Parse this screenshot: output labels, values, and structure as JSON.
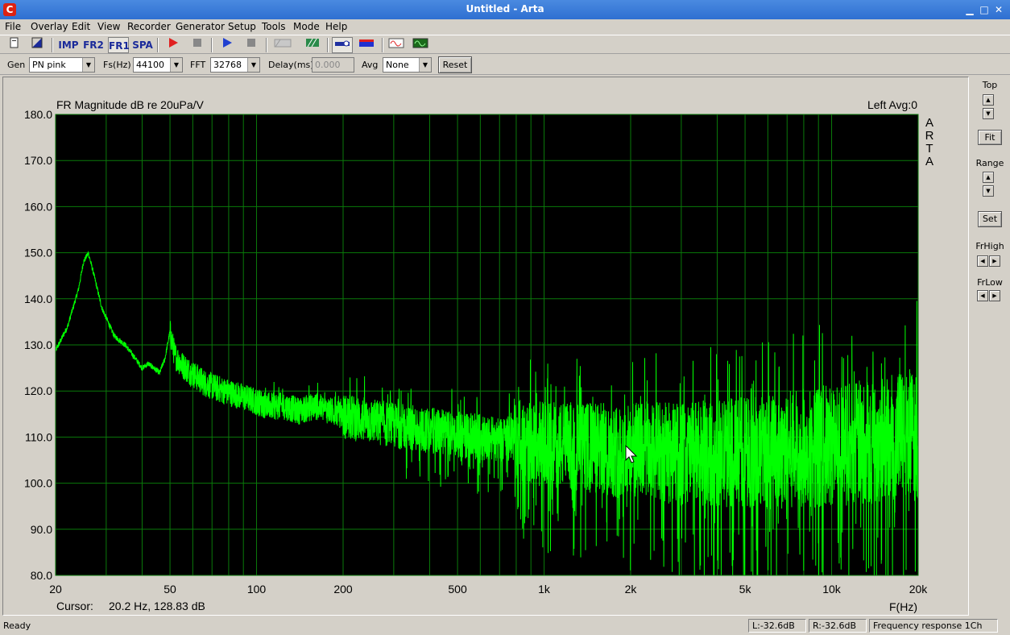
{
  "window": {
    "title": "Untitled - Arta",
    "icon": "arta-logo-icon"
  },
  "menu": [
    "File",
    "Overlay",
    "Edit",
    "View",
    "Recorder",
    "Generator",
    "Setup",
    "Tools",
    "Mode",
    "Help"
  ],
  "toolbar": {
    "imp": "IMP",
    "fr2": "FR2",
    "fr1": "FR1",
    "spa": "SPA",
    "icons": [
      "new-file-icon",
      "open-icon",
      "record-icon",
      "stop-icon",
      "play-icon",
      "stop-icon",
      "abc-icon",
      "hatch-icon",
      "toggle-icon",
      "color-icon",
      "sine-icon",
      "scope-icon"
    ]
  },
  "generator": {
    "gen_label": "Gen",
    "gen_value": "PN pink",
    "fs_label": "Fs(Hz)",
    "fs_value": "44100",
    "fft_label": "FFT",
    "fft_value": "32768",
    "delay_label": "Delay(ms)",
    "delay_value": "0.000",
    "avg_label": "Avg",
    "avg_value": "None",
    "reset_label": "Reset"
  },
  "side": {
    "top": "Top",
    "fit": "Fit",
    "range": "Range",
    "set": "Set",
    "frhigh": "FrHigh",
    "frlow": "FrLow"
  },
  "statusbar": {
    "ready": "Ready",
    "left": "L:-32.6dB",
    "right": "R:-32.6dB",
    "mode": "Frequency response 1Ch"
  },
  "colors": {
    "trace": "#00ff00",
    "grid": "#0a7a0a",
    "plot_bg": "#000000",
    "titlebar": "#3a7bd5"
  },
  "chart_data": {
    "type": "line",
    "title": "FR Magnitude dB re 20uPa/V",
    "channel_info": "Left  Avg:0",
    "watermark": "ARTA",
    "xlabel": "F(Hz)",
    "x_scale": "log",
    "xlim": [
      20,
      20000
    ],
    "ylim": [
      80,
      180
    ],
    "x_ticks": [
      20,
      50,
      100,
      200,
      500,
      1000,
      2000,
      5000,
      10000,
      20000
    ],
    "x_tick_labels": [
      "20",
      "50",
      "100",
      "200",
      "500",
      "1k",
      "2k",
      "5k",
      "10k",
      "20k"
    ],
    "y_ticks": [
      80,
      90,
      100,
      110,
      120,
      130,
      140,
      150,
      160,
      170,
      180
    ],
    "y_tick_labels": [
      "80.0",
      "90.0",
      "100.0",
      "110.0",
      "120.0",
      "130.0",
      "140.0",
      "150.0",
      "160.0",
      "170.0",
      "180.0"
    ],
    "grid": true,
    "cursor": {
      "label": "Cursor:",
      "value": "20.2 Hz, 128.83 dB"
    },
    "series": [
      {
        "x": [
          20,
          22,
          24,
          25,
          26,
          27,
          29,
          32,
          35,
          38,
          40,
          42,
          44,
          46,
          48,
          50,
          52,
          55,
          60,
          66,
          72,
          80,
          90,
          100,
          110,
          125,
          140,
          160,
          180,
          200,
          250,
          300,
          400,
          500,
          600,
          800,
          1000,
          1200,
          1500,
          2000,
          2500,
          3000,
          4000,
          5000,
          6000,
          8000,
          10000,
          12000,
          15000,
          20000
        ],
        "values": [
          128.8,
          134,
          142,
          148,
          150,
          146,
          138,
          132,
          130,
          127,
          125,
          126,
          125,
          124,
          127,
          133,
          128,
          126,
          124,
          122,
          121,
          120,
          119,
          118,
          117,
          117,
          116,
          117,
          116,
          115,
          114,
          113,
          112,
          111,
          110.5,
          110,
          109.5,
          109,
          108.5,
          108,
          108,
          107.5,
          107.5,
          108,
          108,
          109,
          109.5,
          110,
          111,
          112
        ]
      }
    ]
  }
}
